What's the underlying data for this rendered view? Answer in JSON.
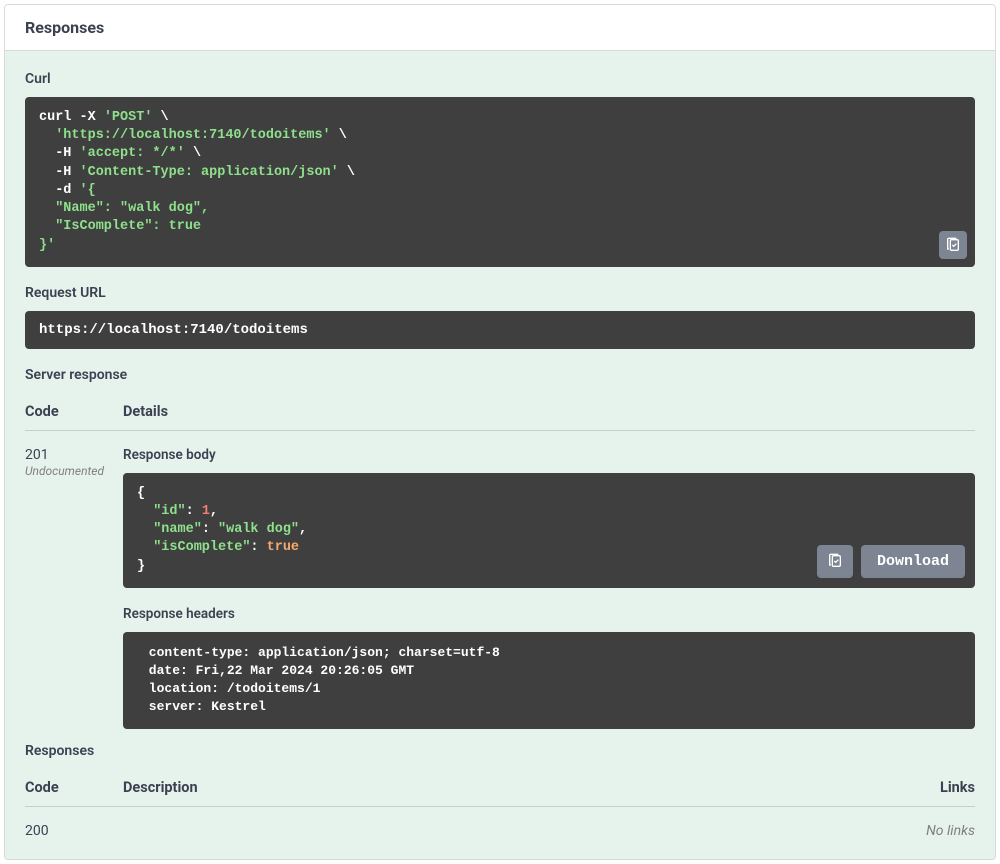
{
  "header": {
    "title": "Responses"
  },
  "curl": {
    "label": "Curl",
    "lines": [
      [
        {
          "t": "curl -X "
        },
        {
          "t": "'POST'",
          "c": "str"
        },
        {
          "t": " \\"
        }
      ],
      [
        {
          "t": "  "
        },
        {
          "t": "'https://localhost:7140/todoitems'",
          "c": "str"
        },
        {
          "t": " \\"
        }
      ],
      [
        {
          "t": "  -H "
        },
        {
          "t": "'accept: */*'",
          "c": "str"
        },
        {
          "t": " \\"
        }
      ],
      [
        {
          "t": "  -H "
        },
        {
          "t": "'Content-Type: application/json'",
          "c": "str"
        },
        {
          "t": " \\"
        }
      ],
      [
        {
          "t": "  -d "
        },
        {
          "t": "'{",
          "c": "str"
        }
      ],
      [
        {
          "t": "  \"Name\": \"walk dog\",",
          "c": "str"
        }
      ],
      [
        {
          "t": "  \"IsComplete\": true",
          "c": "str"
        }
      ],
      [
        {
          "t": "}'",
          "c": "str"
        }
      ]
    ]
  },
  "requestUrl": {
    "label": "Request URL",
    "value": "https://localhost:7140/todoitems"
  },
  "serverResponse": {
    "label": "Server response",
    "colCode": "Code",
    "colDetails": "Details",
    "statusCode": "201",
    "statusNote": "Undocumented",
    "responseBody": {
      "label": "Response body",
      "lines": [
        [
          {
            "t": "{"
          }
        ],
        [
          {
            "t": "  "
          },
          {
            "t": "\"id\"",
            "c": "str"
          },
          {
            "t": ": "
          },
          {
            "t": "1",
            "c": "num"
          },
          {
            "t": ","
          }
        ],
        [
          {
            "t": "  "
          },
          {
            "t": "\"name\"",
            "c": "str"
          },
          {
            "t": ": "
          },
          {
            "t": "\"walk dog\"",
            "c": "str"
          },
          {
            "t": ","
          }
        ],
        [
          {
            "t": "  "
          },
          {
            "t": "\"isComplete\"",
            "c": "str"
          },
          {
            "t": ": "
          },
          {
            "t": "true",
            "c": "bool"
          }
        ],
        [
          {
            "t": "}"
          }
        ]
      ],
      "downloadLabel": "Download"
    },
    "responseHeaders": {
      "label": "Response headers",
      "text": " content-type: application/json; charset=utf-8 \n date: Fri,22 Mar 2024 20:26:05 GMT \n location: /todoitems/1 \n server: Kestrel "
    }
  },
  "responses2": {
    "label": "Responses",
    "colCode": "Code",
    "colDesc": "Description",
    "colLinks": "Links",
    "rows": [
      {
        "code": "200",
        "links": "No links"
      }
    ]
  }
}
